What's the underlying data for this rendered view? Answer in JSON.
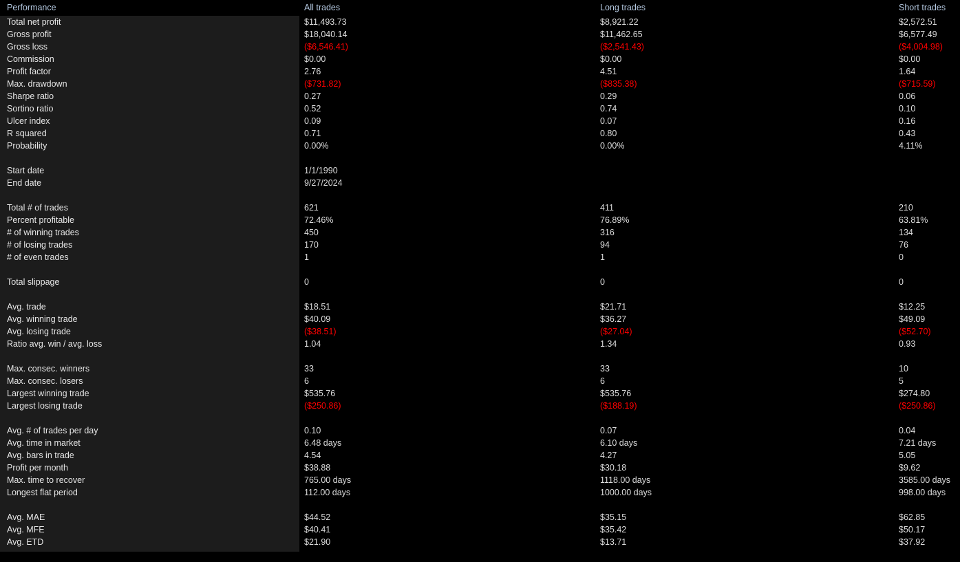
{
  "report": {
    "title": "Performance",
    "columns": {
      "label": "Performance",
      "all": "All trades",
      "long": "Long trades",
      "short": "Short trades"
    },
    "colors": {
      "negative": "#ff0000",
      "header_text": "#b4c8e0",
      "value_text": "#dcdcdc",
      "panel_background": "#1c1c1c",
      "page_background": "#000000"
    },
    "groups": [
      {
        "name": "summary",
        "rows": [
          {
            "label": "Total net profit",
            "all": "$11,493.73",
            "long": "$8,921.22",
            "short": "$2,572.51",
            "negative": false
          },
          {
            "label": "Gross profit",
            "all": "$18,040.14",
            "long": "$11,462.65",
            "short": "$6,577.49",
            "negative": false
          },
          {
            "label": "Gross loss",
            "all": "($6,546.41)",
            "long": "($2,541.43)",
            "short": "($4,004.98)",
            "negative": true
          },
          {
            "label": "Commission",
            "all": "$0.00",
            "long": "$0.00",
            "short": "$0.00",
            "negative": false
          },
          {
            "label": "Profit factor",
            "all": "2.76",
            "long": "4.51",
            "short": "1.64",
            "negative": false
          },
          {
            "label": "Max. drawdown",
            "all": "($731.82)",
            "long": "($835.38)",
            "short": "($715.59)",
            "negative": true
          },
          {
            "label": "Sharpe ratio",
            "all": "0.27",
            "long": "0.29",
            "short": "0.06",
            "negative": false
          },
          {
            "label": "Sortino ratio",
            "all": "0.52",
            "long": "0.74",
            "short": "0.10",
            "negative": false
          },
          {
            "label": "Ulcer index",
            "all": "0.09",
            "long": "0.07",
            "short": "0.16",
            "negative": false
          },
          {
            "label": "R squared",
            "all": "0.71",
            "long": "0.80",
            "short": "0.43",
            "negative": false
          },
          {
            "label": "Probability",
            "all": "0.00%",
            "long": "0.00%",
            "short": "4.11%",
            "negative": false
          }
        ]
      },
      {
        "name": "dates",
        "rows": [
          {
            "label": "Start date",
            "all": "1/1/1990",
            "long": "",
            "short": "",
            "negative": false
          },
          {
            "label": "End date",
            "all": "9/27/2024",
            "long": "",
            "short": "",
            "negative": false
          }
        ]
      },
      {
        "name": "trade-counts",
        "rows": [
          {
            "label": "Total # of trades",
            "all": "621",
            "long": "411",
            "short": "210",
            "negative": false
          },
          {
            "label": "Percent profitable",
            "all": "72.46%",
            "long": "76.89%",
            "short": "63.81%",
            "negative": false
          },
          {
            "label": "# of winning trades",
            "all": "450",
            "long": "316",
            "short": "134",
            "negative": false
          },
          {
            "label": "# of losing trades",
            "all": "170",
            "long": "94",
            "short": "76",
            "negative": false
          },
          {
            "label": "# of even trades",
            "all": "1",
            "long": "1",
            "short": "0",
            "negative": false
          }
        ]
      },
      {
        "name": "slippage",
        "rows": [
          {
            "label": "Total slippage",
            "all": "0",
            "long": "0",
            "short": "0",
            "negative": false
          }
        ]
      },
      {
        "name": "averages",
        "rows": [
          {
            "label": "Avg. trade",
            "all": "$18.51",
            "long": "$21.71",
            "short": "$12.25",
            "negative": false
          },
          {
            "label": "Avg. winning trade",
            "all": "$40.09",
            "long": "$36.27",
            "short": "$49.09",
            "negative": false
          },
          {
            "label": "Avg. losing trade",
            "all": "($38.51)",
            "long": "($27.04)",
            "short": "($52.70)",
            "negative": true
          },
          {
            "label": "Ratio avg. win / avg. loss",
            "all": "1.04",
            "long": "1.34",
            "short": "0.93",
            "negative": false
          }
        ]
      },
      {
        "name": "streaks",
        "rows": [
          {
            "label": "Max. consec. winners",
            "all": "33",
            "long": "33",
            "short": "10",
            "negative": false
          },
          {
            "label": "Max. consec. losers",
            "all": "6",
            "long": "6",
            "short": "5",
            "negative": false
          },
          {
            "label": "Largest winning trade",
            "all": "$535.76",
            "long": "$535.76",
            "short": "$274.80",
            "negative": false
          },
          {
            "label": "Largest losing trade",
            "all": "($250.86)",
            "long": "($188.19)",
            "short": "($250.86)",
            "negative": true
          }
        ]
      },
      {
        "name": "time-stats",
        "rows": [
          {
            "label": "Avg. # of trades per day",
            "all": "0.10",
            "long": "0.07",
            "short": "0.04",
            "negative": false
          },
          {
            "label": "Avg. time in market",
            "all": "6.48 days",
            "long": "6.10 days",
            "short": "7.21 days",
            "negative": false
          },
          {
            "label": "Avg. bars in trade",
            "all": "4.54",
            "long": "4.27",
            "short": "5.05",
            "negative": false
          },
          {
            "label": "Profit per month",
            "all": "$38.88",
            "long": "$30.18",
            "short": "$9.62",
            "negative": false
          },
          {
            "label": "Max. time to recover",
            "all": "765.00 days",
            "long": "1118.00 days",
            "short": "3585.00 days",
            "negative": false
          },
          {
            "label": "Longest flat period",
            "all": "112.00 days",
            "long": "1000.00 days",
            "short": "998.00 days",
            "negative": false
          }
        ]
      },
      {
        "name": "excursions",
        "rows": [
          {
            "label": "Avg. MAE",
            "all": "$44.52",
            "long": "$35.15",
            "short": "$62.85",
            "negative": false
          },
          {
            "label": "Avg. MFE",
            "all": "$40.41",
            "long": "$35.42",
            "short": "$50.17",
            "negative": false
          },
          {
            "label": "Avg. ETD",
            "all": "$21.90",
            "long": "$13.71",
            "short": "$37.92",
            "negative": false
          }
        ]
      }
    ]
  }
}
